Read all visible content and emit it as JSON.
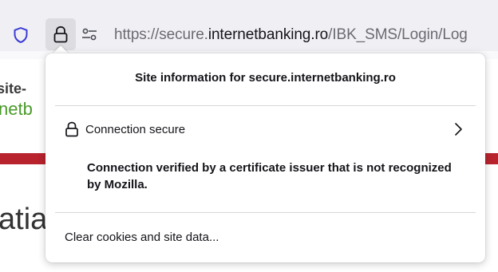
{
  "urlbar": {
    "scheme": "https://secure.",
    "host": "internetbanking.ro",
    "path": "/IBK_SMS/Login/Log",
    "tracking_icon": "shield-icon",
    "lock_icon": "lock-icon",
    "permissions_icon": "permissions-sliders-icon"
  },
  "page_background": {
    "line1": "site-",
    "line2": "netb",
    "line3": "atia",
    "accent_bar_color": "#b8232d"
  },
  "site_info_panel": {
    "title": "Site information for secure.internetbanking.ro",
    "connection": {
      "icon": "lock-icon",
      "label": "Connection secure",
      "chevron": "chevron-right-icon"
    },
    "verification_text": "Connection verified by a certificate issuer that is not recognized by Mozilla.",
    "clear_data_label": "Clear cookies and site data..."
  }
}
